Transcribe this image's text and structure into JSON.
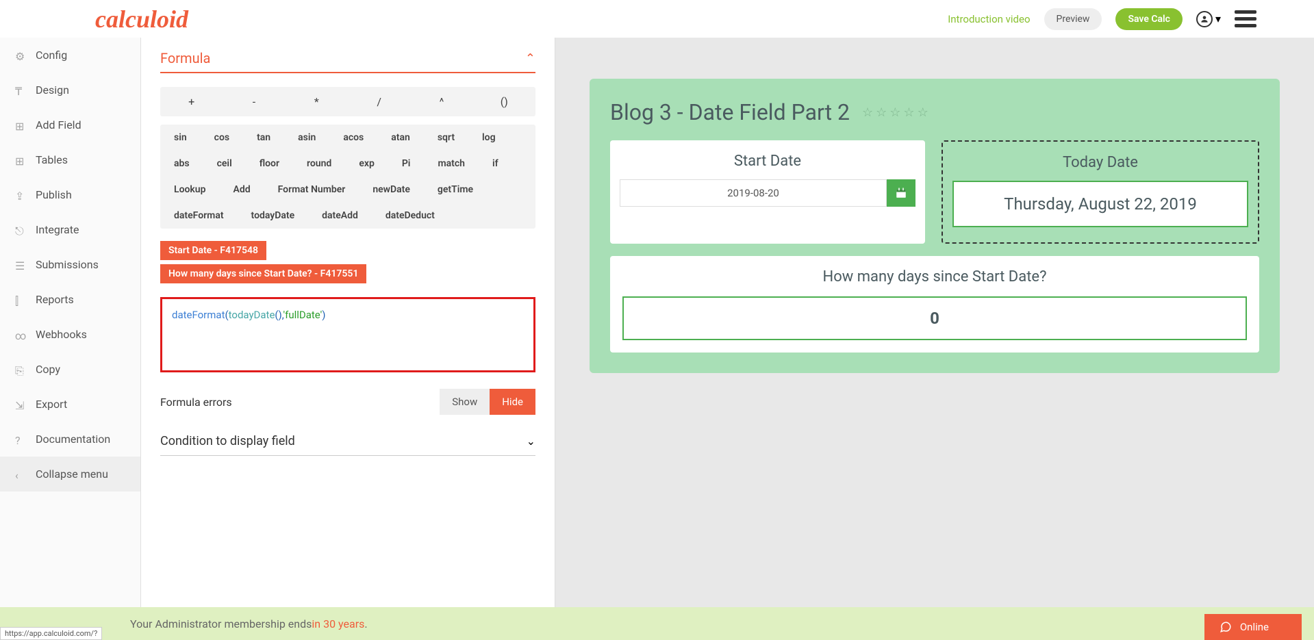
{
  "header": {
    "logo": "calculoid",
    "intro_link": "Introduction video",
    "preview": "Preview",
    "save": "Save Calc"
  },
  "sidebar": {
    "items": [
      {
        "label": "Config",
        "icon": "gear"
      },
      {
        "label": "Design",
        "icon": "text"
      },
      {
        "label": "Add Field",
        "icon": "plus"
      },
      {
        "label": "Tables",
        "icon": "table"
      },
      {
        "label": "Publish",
        "icon": "upload"
      },
      {
        "label": "Integrate",
        "icon": "share"
      },
      {
        "label": "Submissions",
        "icon": "list"
      },
      {
        "label": "Reports",
        "icon": "chart"
      },
      {
        "label": "Webhooks",
        "icon": "hooks"
      },
      {
        "label": "Copy",
        "icon": "copy"
      },
      {
        "label": "Export",
        "icon": "export"
      },
      {
        "label": "Documentation",
        "icon": "help"
      },
      {
        "label": "Collapse menu",
        "icon": "collapse"
      }
    ]
  },
  "formula": {
    "title": "Formula",
    "operators": [
      "+",
      "-",
      "*",
      "/",
      "^",
      "()"
    ],
    "functions": [
      "sin",
      "cos",
      "tan",
      "asin",
      "acos",
      "atan",
      "sqrt",
      "log",
      "abs",
      "ceil",
      "floor",
      "round",
      "exp",
      "Pi",
      "match",
      "if",
      "Lookup",
      "Add",
      "Format Number",
      "newDate",
      "getTime",
      "dateFormat",
      "todayDate",
      "dateAdd",
      "dateDeduct"
    ],
    "field_tags": [
      "Start Date - F417548",
      "How many days since Start Date? - F417551"
    ],
    "expression": {
      "p1": "dateFormat",
      "p2": "(",
      "p3": "todayDate",
      "p4": "(),",
      "p5": "'fullDate'",
      "p6": ")"
    },
    "errors_label": "Formula errors",
    "show": "Show",
    "hide": "Hide",
    "condition_title": "Condition to display field"
  },
  "calc": {
    "title": "Blog 3 - Date Field Part 2",
    "start_date_label": "Start Date",
    "start_date_value": "2019-08-20",
    "today_label": "Today Date",
    "today_value": "Thursday, August 22, 2019",
    "days_label": "How many days since Start Date?",
    "days_value": "0"
  },
  "footer": {
    "text1": "Your Administrator membership ends ",
    "text2": "in 30 years",
    "text3": "."
  },
  "status_url": "https://app.calculoid.com/?",
  "online": "Online"
}
